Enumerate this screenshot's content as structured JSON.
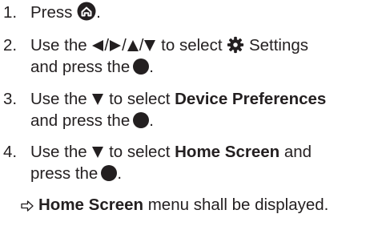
{
  "steps": [
    {
      "number": "1.",
      "lead": "Press",
      "tail": ".",
      "icon": "home-button-icon"
    },
    {
      "number": "2.",
      "lead": "Use the",
      "mid": "to select",
      "settings_label": "Settings",
      "line2_lead": "and press the",
      "line2_tail": ".",
      "icons": [
        "left-arrow-icon",
        "right-arrow-icon",
        "up-arrow-icon",
        "down-arrow-icon",
        "gear-icon",
        "ok-button-icon"
      ]
    },
    {
      "number": "3.",
      "lead": "Use the",
      "mid": "to select",
      "bold": "Device Preferences",
      "line2_lead": "and press the",
      "line2_tail": ".",
      "icons": [
        "down-arrow-icon",
        "ok-button-icon"
      ]
    },
    {
      "number": "4.",
      "lead": "Use the",
      "mid": "to select",
      "bold": "Home Screen",
      "after_bold": "and",
      "line2_lead": "press the",
      "line2_tail": ".",
      "icons": [
        "down-arrow-icon",
        "ok-button-icon"
      ]
    }
  ],
  "result": {
    "bold": "Home Screen",
    "text": "menu shall be displayed.",
    "icon": "result-arrow-icon"
  },
  "separator": "/",
  "colors": {
    "text": "#231f20"
  }
}
